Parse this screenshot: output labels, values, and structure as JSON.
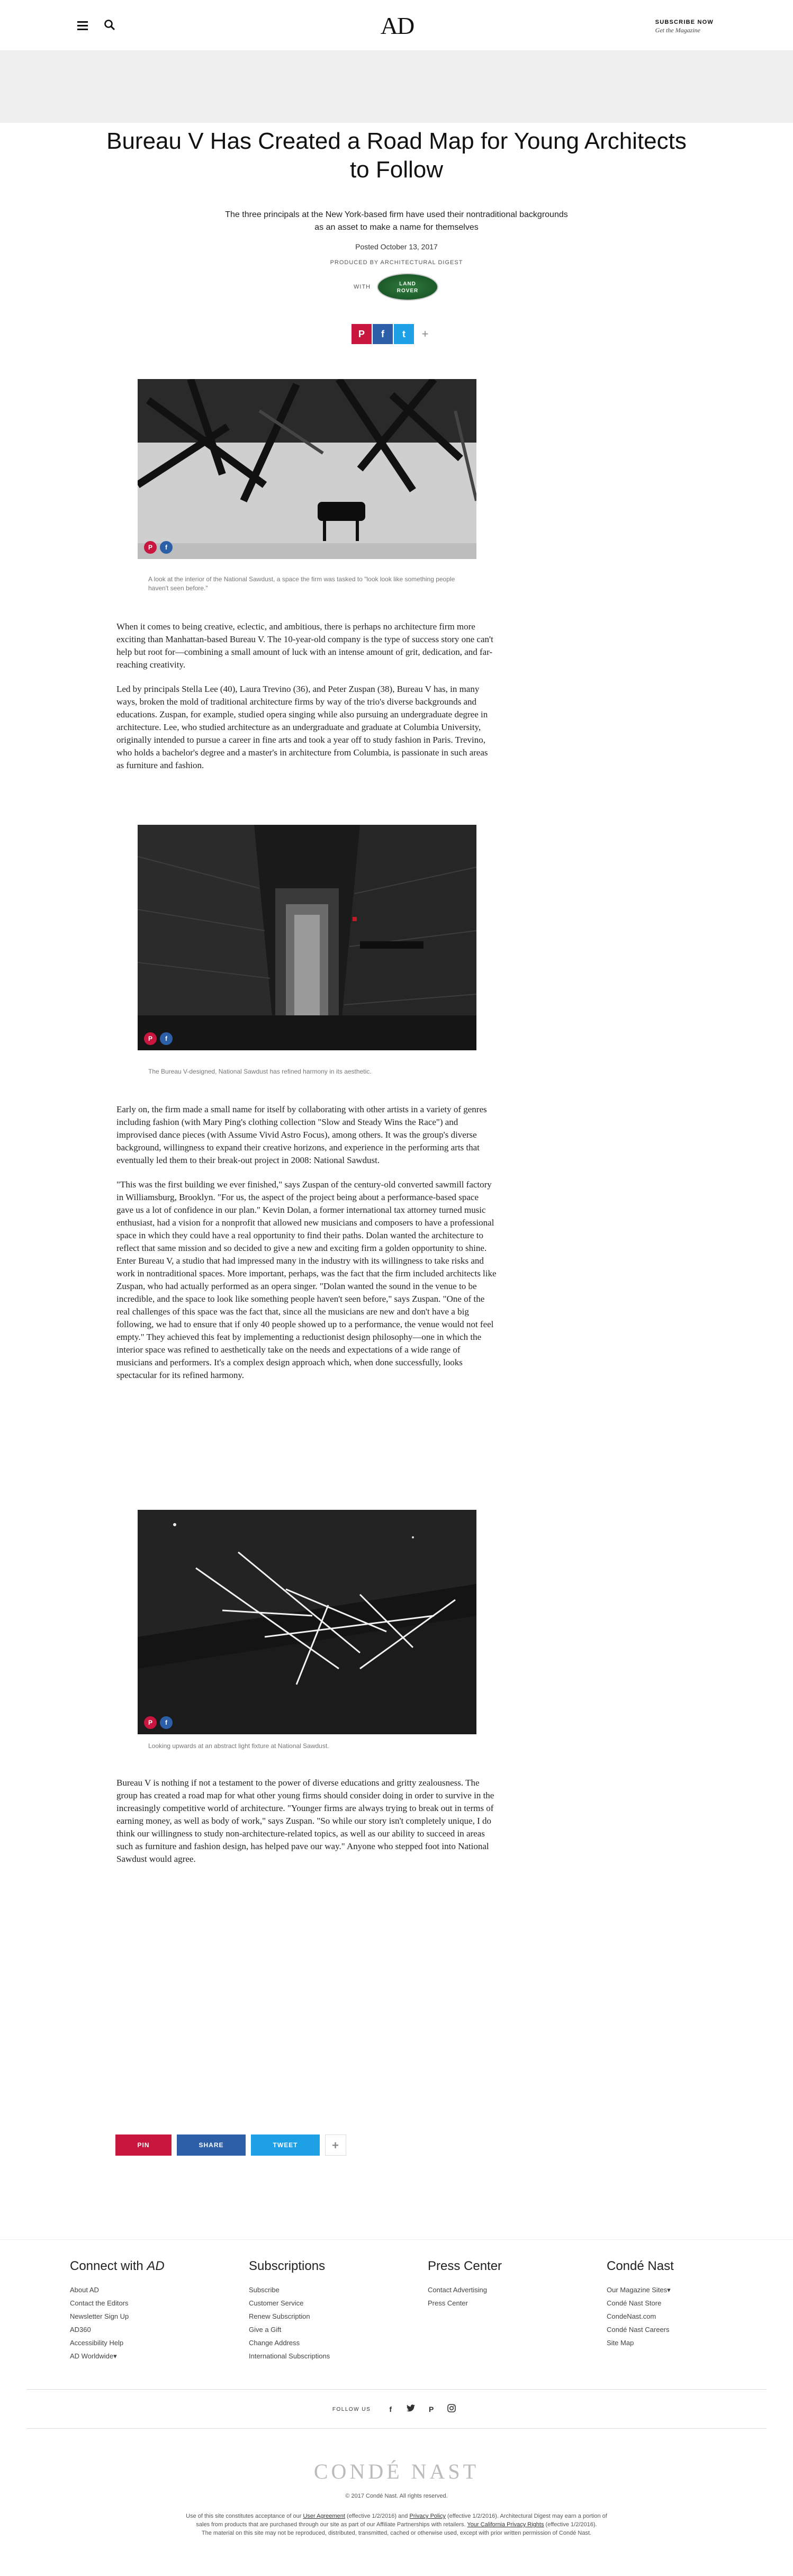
{
  "header": {
    "menu_icon": "hamburger-icon",
    "search_icon": "search-icon",
    "logo": "AD",
    "subscribe_line1": "SUBSCRIBE NOW",
    "subscribe_line2": "Get the Magazine"
  },
  "article": {
    "headline": "Bureau V Has Created a Road Map for Young Architects to Follow",
    "dek": "The three principals at the New York-based firm have used their nontraditional backgrounds as an asset to make a name for themselves",
    "posted": "Posted October 13, 2017",
    "produced_by": "PRODUCED BY ARCHITECTURAL DIGEST",
    "with_label": "WITH",
    "sponsor_line1": "LAND",
    "sponsor_line2": "ROVER",
    "share_top": {
      "pin": "P",
      "facebook": "f",
      "twitter": "t",
      "more": "+"
    },
    "images": [
      {
        "caption": "A look at the interior of the National Sawdust, a space the firm was tasked to \"look look like something people haven't seen before.\""
      },
      {
        "caption": "The Bureau V-designed, National Sawdust has refined harmony in its aesthetic."
      },
      {
        "caption": "Looking upwards at an abstract light fixture at National Sawdust."
      }
    ],
    "image_buttons": {
      "pin": "P",
      "facebook": "f"
    },
    "paragraphs": [
      "When it comes to being creative, eclectic, and ambitious, there is perhaps no architecture firm more exciting than Manhattan-based Bureau V. The 10-year-old company is the type of success story one can't help but root for—combining a small amount of luck with an intense amount of grit, dedication, and far-reaching creativity.",
      "Led by principals Stella Lee (40), Laura Trevino (36), and Peter Zuspan (38), Bureau V has, in many ways, broken the mold of traditional architecture firms by way of the trio's diverse backgrounds and educations. Zuspan, for example, studied opera singing while also pursuing an undergraduate degree in architecture. Lee, who studied architecture as an undergraduate and graduate at Columbia University, originally intended to pursue a career in fine arts and took a year off to study fashion in Paris. Trevino, who holds a bachelor's degree and a master's in architecture from Columbia, is passionate in such areas as furniture and fashion.",
      "Early on, the firm made a small name for itself by collaborating with other artists in a variety of genres including fashion (with Mary Ping's clothing collection \"Slow and Steady Wins the Race\") and improvised dance pieces (with Assume Vivid Astro Focus), among others. It was the group's diverse background, willingness to expand their creative horizons, and experience in the performing arts that eventually led them to their break-out project in 2008: National Sawdust.",
      "\"This was the first building we ever finished,\" says Zuspan of the century-old converted sawmill factory in Williamsburg, Brooklyn. \"For us, the aspect of the project being about a performance-based space gave us a lot of confidence in our plan.\" Kevin Dolan, a former international tax attorney turned music enthusiast, had a vision for a nonprofit that allowed new musicians and composers to have a professional space in which they could have a real opportunity to find their paths. Dolan wanted the architecture to reflect that same mission and so decided to give a new and exciting firm a golden opportunity to shine. Enter Bureau V, a studio that had impressed many in the industry with its willingness to take risks and work in nontraditional spaces. More important, perhaps, was the fact that the firm included architects like Zuspan, who had actually performed as an opera singer. \"Dolan wanted the sound in the venue to be incredible, and the space to look like something people haven't seen before,\" says Zuspan. \"One of the real challenges of this space was the fact that, since all the musicians are new and don't have a big following, we had to ensure that if only 40 people showed up to a performance, the venue would not feel empty.\" They achieved this feat by implementing a reductionist design philosophy—one in which the interior space was refined to aesthetically take on the needs and expectations of a wide range of musicians and performers. It's a complex design approach which, when done successfully, looks spectacular for its refined harmony.",
      "Bureau V is nothing if not a testament to the power of diverse educations and gritty zealousness. The group has created a road map for what other young firms should consider doing in order to survive in the increasingly competitive world of architecture. \"Younger firms are always trying to break out in terms of earning money, as well as body of work,\" says Zuspan. \"So while our story isn't completely unique, I do think our willingness to study non-architecture-related topics, as well as our ability to succeed in areas such as furniture and fashion design, has helped pave our way.\" Anyone who stepped foot into National Sawdust would agree."
    ],
    "share_bottom": {
      "pin": "PIN",
      "share": "SHARE",
      "tweet": "TWEET",
      "more": "+"
    }
  },
  "footer": {
    "connect_title_a": "Connect with ",
    "connect_title_b": "AD",
    "connect_links": [
      "About AD",
      "Contact the Editors",
      "Newsletter Sign Up",
      "AD360",
      "Accessibility Help",
      "AD Worldwide▾"
    ],
    "subscriptions_title": "Subscriptions",
    "subscriptions_links": [
      "Subscribe",
      "Customer Service",
      "Renew Subscription",
      "Give a Gift",
      "Change Address",
      "International Subscriptions"
    ],
    "press_title": "Press Center",
    "press_links": [
      "Contact Advertising",
      "Press Center"
    ],
    "conde_title": "Condé Nast",
    "conde_links": [
      "Our Magazine Sites▾",
      "Condé Nast Store",
      "CondeNast.com",
      "Condé Nast Careers",
      "Site Map"
    ],
    "follow_label": "FOLLOW US",
    "social_icons": [
      "facebook-icon",
      "twitter-icon",
      "pinterest-icon",
      "instagram-icon"
    ],
    "brand": "CONDÉ NAST",
    "copyright": "© 2017 Condé Nast. All rights reserved.",
    "legal_pre": "Use of this site constitutes acceptance of our ",
    "legal_user_agreement": "User Agreement",
    "legal_mid1": " (effective 1/2/2016) and ",
    "legal_privacy": "Privacy Policy",
    "legal_mid2": " (effective 1/2/2016). Architectural Digest may earn a portion of sales from products that are purchased through our site as part of our Affiliate Partnerships with retailers. ",
    "legal_ca": "Your California Privacy Rights",
    "legal_mid3": " (effective 1/2/2016).",
    "legal_line2": "The material on this site may not be reproduced, distributed, transmitted, cached or otherwise used, except with prior written permission of Condé Nast."
  }
}
